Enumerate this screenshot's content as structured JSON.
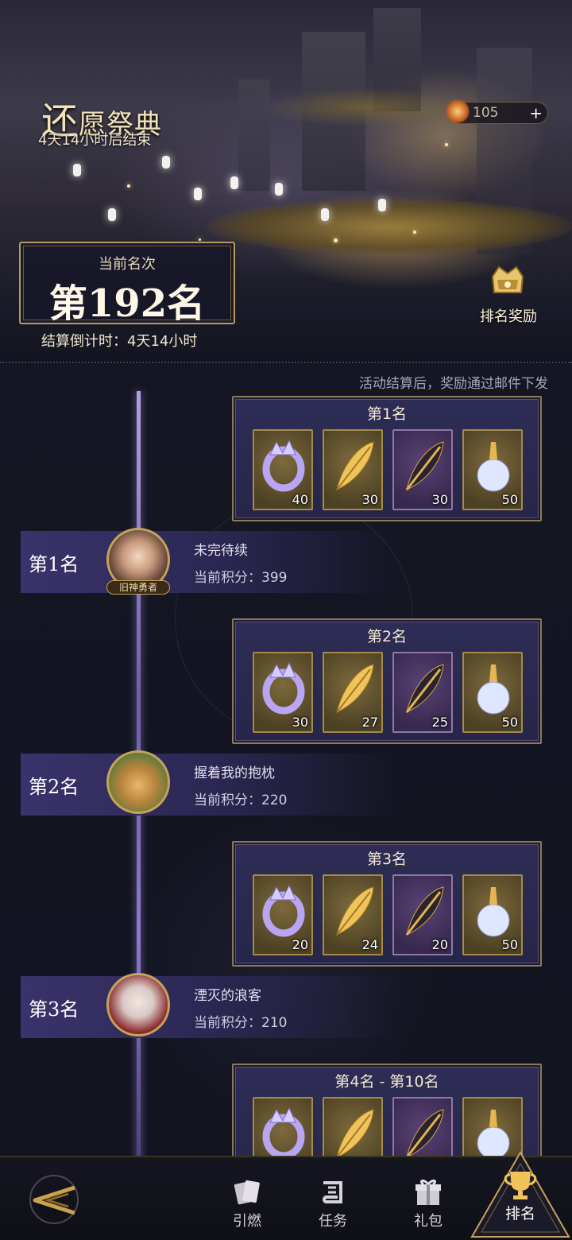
{
  "event": {
    "title_first_char": "还",
    "title_rest": "愿祭典",
    "ends_in": "4天14小时后结束"
  },
  "currency": {
    "amount": "105",
    "plus": "+"
  },
  "my_rank": {
    "label": "当前名次",
    "value": "第192名",
    "countdown": "结算倒计时：4天14小时"
  },
  "reward_button": {
    "label": "排名奖励"
  },
  "notice": "活动结算后，奖励通过邮件下发",
  "reward_tiers": [
    {
      "title": "第1名",
      "items": [
        {
          "icon": "crystal-ring-icon",
          "qty": "40"
        },
        {
          "icon": "golden-feather-icon",
          "qty": "30"
        },
        {
          "icon": "dark-feather-icon",
          "qty": "30"
        },
        {
          "icon": "crystal-vial-icon",
          "qty": "50"
        }
      ]
    },
    {
      "title": "第2名",
      "items": [
        {
          "icon": "crystal-ring-icon",
          "qty": "30"
        },
        {
          "icon": "golden-feather-icon",
          "qty": "27"
        },
        {
          "icon": "dark-feather-icon",
          "qty": "25"
        },
        {
          "icon": "crystal-vial-icon",
          "qty": "50"
        }
      ]
    },
    {
      "title": "第3名",
      "items": [
        {
          "icon": "crystal-ring-icon",
          "qty": "20"
        },
        {
          "icon": "golden-feather-icon",
          "qty": "24"
        },
        {
          "icon": "dark-feather-icon",
          "qty": "20"
        },
        {
          "icon": "crystal-vial-icon",
          "qty": "50"
        }
      ]
    },
    {
      "title": "第4名 - 第10名",
      "items": [
        {
          "icon": "crystal-ring-icon",
          "qty": ""
        },
        {
          "icon": "golden-feather-icon",
          "qty": ""
        },
        {
          "icon": "dark-feather-icon",
          "qty": ""
        },
        {
          "icon": "crystal-vial-icon",
          "qty": ""
        }
      ]
    }
  ],
  "leaderboard": [
    {
      "place": "第1名",
      "name": "未完待续",
      "score": "当前积分：399",
      "title_tag": "旧神勇者"
    },
    {
      "place": "第2名",
      "name": "握着我的抱枕",
      "score": "当前积分：220"
    },
    {
      "place": "第3名",
      "name": "湮灭的浪客",
      "score": "当前积分：210"
    }
  ],
  "nav": {
    "tabs": [
      {
        "label": "引燃",
        "icon": "cards-icon"
      },
      {
        "label": "任务",
        "icon": "scroll-icon"
      },
      {
        "label": "礼包",
        "icon": "gift-icon"
      },
      {
        "label": "排名",
        "icon": "trophy-icon",
        "active": true
      }
    ]
  },
  "colors": {
    "accent_gold": "#c4a35c",
    "panel_purple": "#2e2d55",
    "background": "#12141f"
  }
}
